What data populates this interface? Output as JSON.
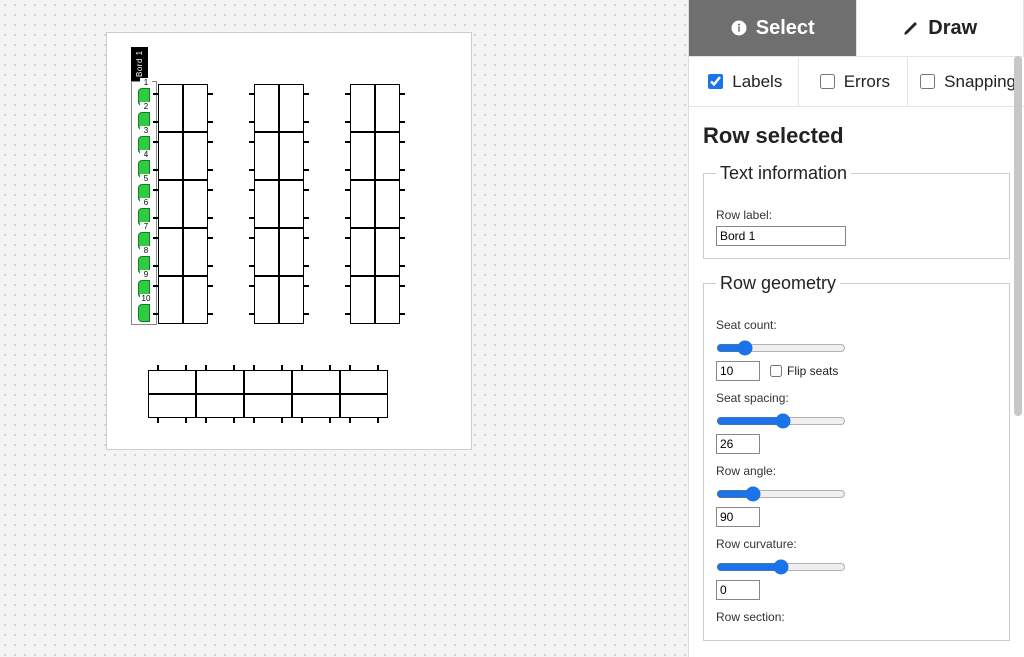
{
  "tools": {
    "select_label": "Select",
    "draw_label": "Draw",
    "active": "select"
  },
  "toggles": {
    "labels_label": "Labels",
    "labels_checked": true,
    "errors_label": "Errors",
    "errors_checked": false,
    "snapping_label": "Snapping",
    "snapping_checked": false
  },
  "panel": {
    "heading": "Row selected",
    "text_legend": "Text information",
    "row_label_label": "Row label:",
    "row_label_value": "Bord 1",
    "geom_legend": "Row geometry",
    "seat_count_label": "Seat count:",
    "seat_count_value": "10",
    "flip_seats_label": "Flip seats",
    "flip_seats_checked": false,
    "seat_spacing_label": "Seat spacing:",
    "seat_spacing_value": "26",
    "row_angle_label": "Row angle:",
    "row_angle_value": "90",
    "row_curvature_label": "Row curvature:",
    "row_curvature_value": "0",
    "row_section_label": "Row section:"
  },
  "canvas": {
    "row_tag_text": "Bord 1",
    "seat_numbers": [
      "1",
      "2",
      "3",
      "4",
      "5",
      "6",
      "7",
      "8",
      "9",
      "10"
    ],
    "groups_vertical": 3,
    "seats_per_column": 5,
    "group_horizontal_cols": 5
  }
}
